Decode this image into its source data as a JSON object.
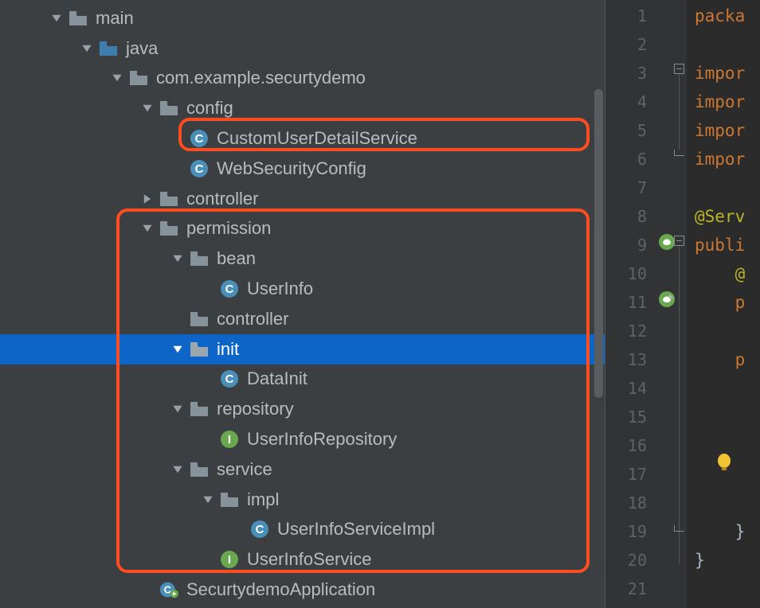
{
  "tree": {
    "main": "main",
    "java": "java",
    "pkg": "com.example.securtydemo",
    "config": "config",
    "customUserDetailService": "CustomUserDetailService",
    "webSecurityConfig": "WebSecurityConfig",
    "controller": "controller",
    "permission": "permission",
    "bean": "bean",
    "userInfo": "UserInfo",
    "permController": "controller",
    "init": "init",
    "dataInit": "DataInit",
    "repository": "repository",
    "userInfoRepository": "UserInfoRepository",
    "service": "service",
    "impl": "impl",
    "userInfoServiceImpl": "UserInfoServiceImpl",
    "userInfoService": "UserInfoService",
    "app": "SecurtydemoApplication"
  },
  "lineNumbers": [
    "1",
    "2",
    "3",
    "4",
    "5",
    "6",
    "7",
    "8",
    "9",
    "10",
    "11",
    "12",
    "13",
    "14",
    "15",
    "16",
    "17",
    "18",
    "19",
    "20",
    "21"
  ],
  "code": {
    "l1": "packa",
    "l3": "impor",
    "l4": "impor",
    "l5": "impor",
    "l6": "impor",
    "l8": "@Serv",
    "l9a": "publi",
    "l10": "@",
    "l11": "p",
    "l13": "p",
    "l19": "}",
    "l20": "}"
  }
}
